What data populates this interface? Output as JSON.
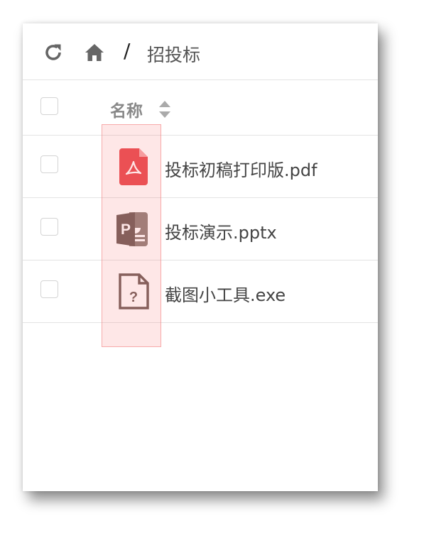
{
  "toolbar": {
    "refresh_icon": "refresh-icon",
    "home_icon": "home-icon",
    "separator": "/",
    "breadcrumb_current": "招投标"
  },
  "table": {
    "column_name": "名称",
    "sort_icon": "sort-icon",
    "rows": [
      {
        "name": "投标初稿打印版.pdf",
        "icon": "pdf-file-icon",
        "icon_color": "#e8474c"
      },
      {
        "name": "投标演示.pptx",
        "icon": "powerpoint-file-icon",
        "icon_color": "#6d5a55"
      },
      {
        "name": "截图小工具.exe",
        "icon": "unknown-file-icon",
        "icon_color": "#6d5a55"
      }
    ]
  },
  "colors": {
    "highlight": "#f8a0a0",
    "border": "#e3e3e3",
    "muted_text": "#888888"
  }
}
